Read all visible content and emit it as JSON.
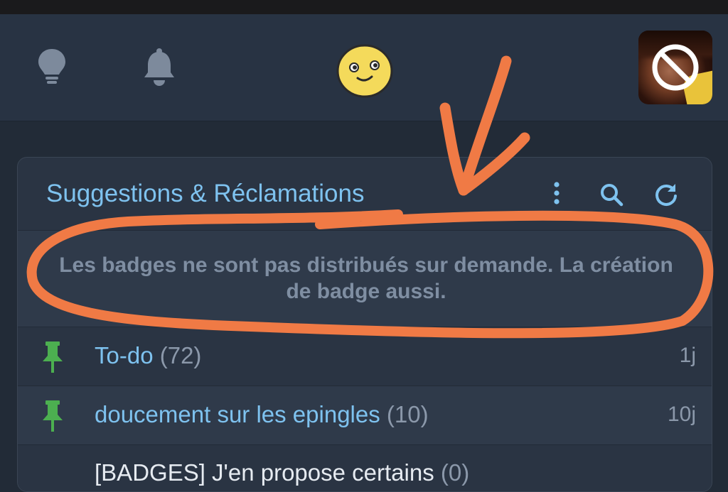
{
  "nav": {
    "icons": [
      "lightbulb-icon",
      "bell-icon",
      "smiley-emoji",
      "avatar-blocked"
    ]
  },
  "category": {
    "title": "Suggestions & Réclamations",
    "actions": [
      "more-vertical-icon",
      "search-icon",
      "refresh-icon"
    ],
    "notice": "Les badges ne sont pas distribués sur demande. La création de badge aussi."
  },
  "topics": [
    {
      "title": "To-do",
      "count": "(72)",
      "age": "1j",
      "pinned": true
    },
    {
      "title": "doucement sur les epingles",
      "count": "(10)",
      "age": "10j",
      "pinned": true
    },
    {
      "title": "[BADGES] J'en propose certains",
      "count": "(0)",
      "age": "",
      "pinned": false
    }
  ],
  "colors": {
    "accent_blue": "#7ec2ef",
    "pin_green": "#4caf50",
    "annotation_orange": "#f07a45",
    "background": "#222b37"
  }
}
